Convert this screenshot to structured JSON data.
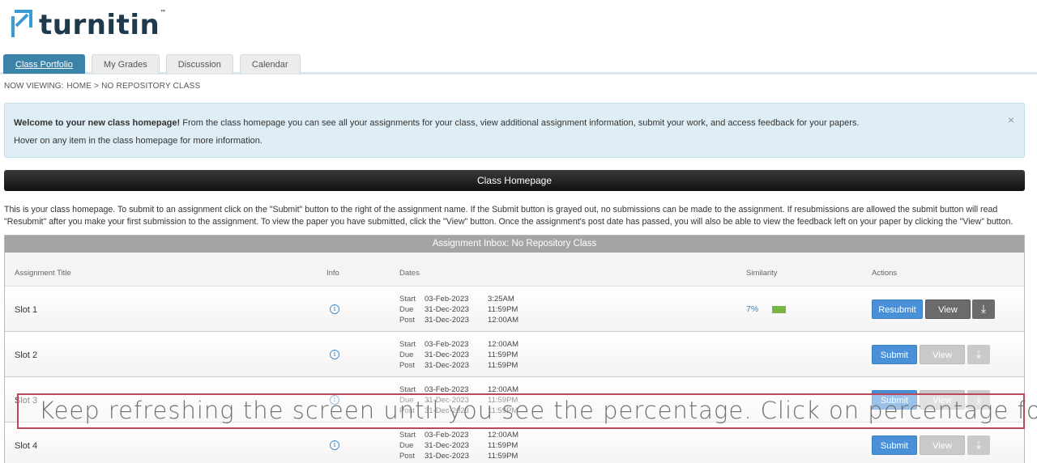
{
  "logo": {
    "text": "turnitin",
    "tm": "™"
  },
  "tabs": [
    {
      "label": "Class Portfolio",
      "active": true
    },
    {
      "label": "My Grades",
      "active": false
    },
    {
      "label": "Discussion",
      "active": false
    },
    {
      "label": "Calendar",
      "active": false
    }
  ],
  "breadcrumb": {
    "prefix": "NOW VIEWING:",
    "path": "HOME > NO REPOSITORY CLASS"
  },
  "welcome": {
    "bold": "Welcome to your new class homepage!",
    "text": " From the class homepage you can see all your assignments for your class, view additional assignment information, submit your work, and access feedback for your papers.",
    "hover": "Hover on any item in the class homepage for more information.",
    "close": "×"
  },
  "homepage_bar": "Class Homepage",
  "intro": "This is your class homepage. To submit to an assignment click on the \"Submit\" button to the right of the assignment name. If the Submit button is grayed out, no submissions can be made to the assignment. If resubmissions are allowed the submit button will read \"Resubmit\" after you make your first submission to the assignment. To view the paper you have submitted, click the \"View\" button. Once the assignment's post date has passed, you will also be able to view the feedback left on your paper by clicking the \"View\" button.",
  "inbox": {
    "title": "Assignment Inbox: No Repository Class",
    "headers": {
      "title": "Assignment Title",
      "info": "Info",
      "dates": "Dates",
      "similarity": "Similarity",
      "actions": "Actions"
    },
    "rows": [
      {
        "title": "Slot 1",
        "start": "03-Feb-2023",
        "start_time": "3:25AM",
        "due": "31-Dec-2023",
        "due_time": "11:59PM",
        "post": "31-Dec-2023",
        "post_time": "12:00AM",
        "similarity": "7%",
        "action": "Resubmit",
        "view": "View"
      },
      {
        "title": "Slot 2",
        "start": "03-Feb-2023",
        "start_time": "12:00AM",
        "due": "31-Dec-2023",
        "due_time": "11:59PM",
        "post": "31-Dec-2023",
        "post_time": "11:59PM",
        "similarity": "",
        "action": "Submit",
        "view": "View"
      },
      {
        "title": "Slot 3",
        "start": "03-Feb-2023",
        "start_time": "12:00AM",
        "due": "31-Dec-2023",
        "due_time": "11:59PM",
        "post": "31-Dec-2023",
        "post_time": "11:59PM",
        "similarity": "",
        "action": "Submit",
        "view": "View"
      },
      {
        "title": "Slot 4",
        "start": "03-Feb-2023",
        "start_time": "12:00AM",
        "due": "31-Dec-2023",
        "due_time": "11:59PM",
        "post": "31-Dec-2023",
        "post_time": "11:59PM",
        "similarity": "",
        "action": "Submit",
        "view": "View"
      }
    ],
    "date_labels": {
      "start": "Start",
      "due": "Due",
      "post": "Post"
    },
    "info_glyph": "i",
    "download_glyph": "⤓"
  },
  "caption": "Keep refreshing the screen until you see the percentage. Click on percentage for more detail",
  "colors": {
    "brand": "#1f3a4d",
    "tab_active": "#3b83a8",
    "button_blue": "#4a90d9",
    "similarity_bar": "#78b64a",
    "caption_border": "#b9485a"
  }
}
